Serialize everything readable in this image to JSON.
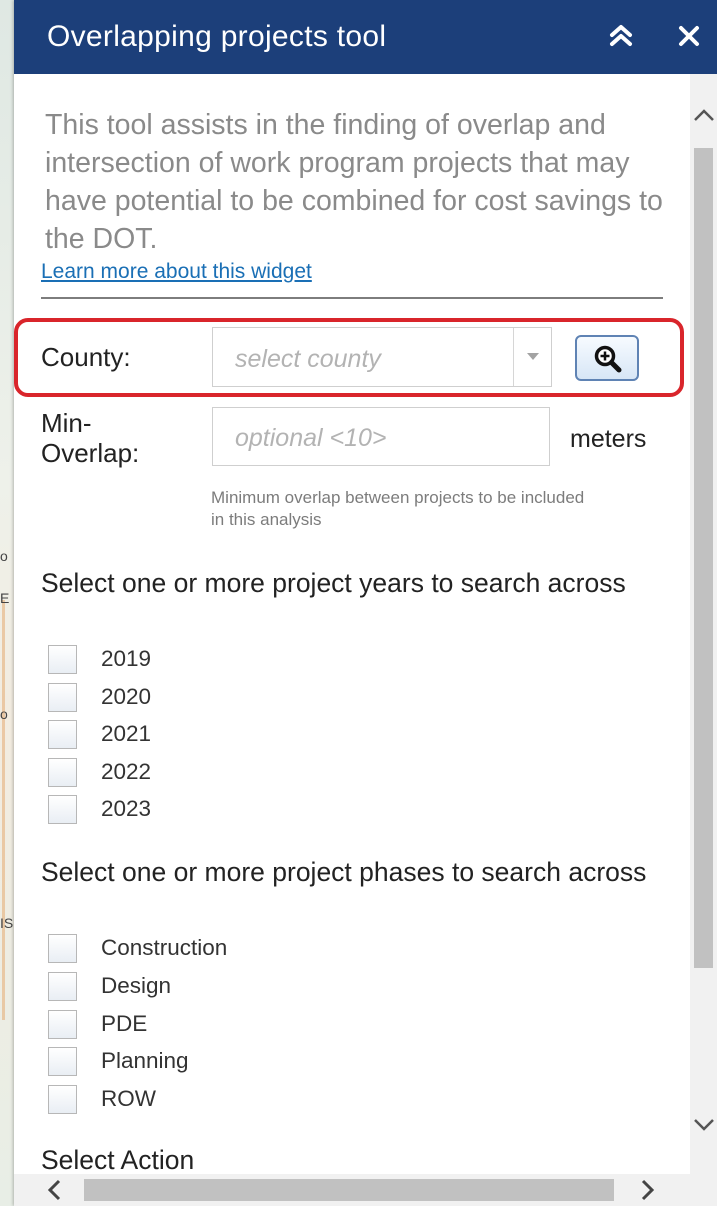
{
  "widget": {
    "title": "Overlapping projects tool",
    "collapse_icon": "double-chevron-up-icon",
    "close_icon": "close-icon"
  },
  "intro": {
    "text": "This tool assists in the finding of overlap and intersection of work program projects that may have potential to be combined for cost savings to the DOT.",
    "learn_more": "Learn more about this widget"
  },
  "county": {
    "label": "County:",
    "placeholder": "select county",
    "search_icon": "magnifier-icon"
  },
  "min_overlap": {
    "label": "Min-\nOverlap:",
    "placeholder": "optional <10>",
    "unit": "meters",
    "hint": "Minimum overlap between projects to be included in this analysis"
  },
  "years": {
    "title": "Select one or more project years to search across",
    "options": [
      "2019",
      "2020",
      "2021",
      "2022",
      "2023"
    ]
  },
  "phases": {
    "title": "Select one or more project phases to search across",
    "options": [
      "Construction",
      "Design",
      "PDE",
      "Planning",
      "ROW"
    ]
  },
  "action": {
    "title": "Select Action"
  },
  "scrollbars": {
    "up": "^",
    "down": "⌄",
    "left": "<",
    "right": ">"
  },
  "colors": {
    "titlebar": "#1c3f7a",
    "highlight": "#d9252b",
    "link": "#1a6fb5"
  }
}
